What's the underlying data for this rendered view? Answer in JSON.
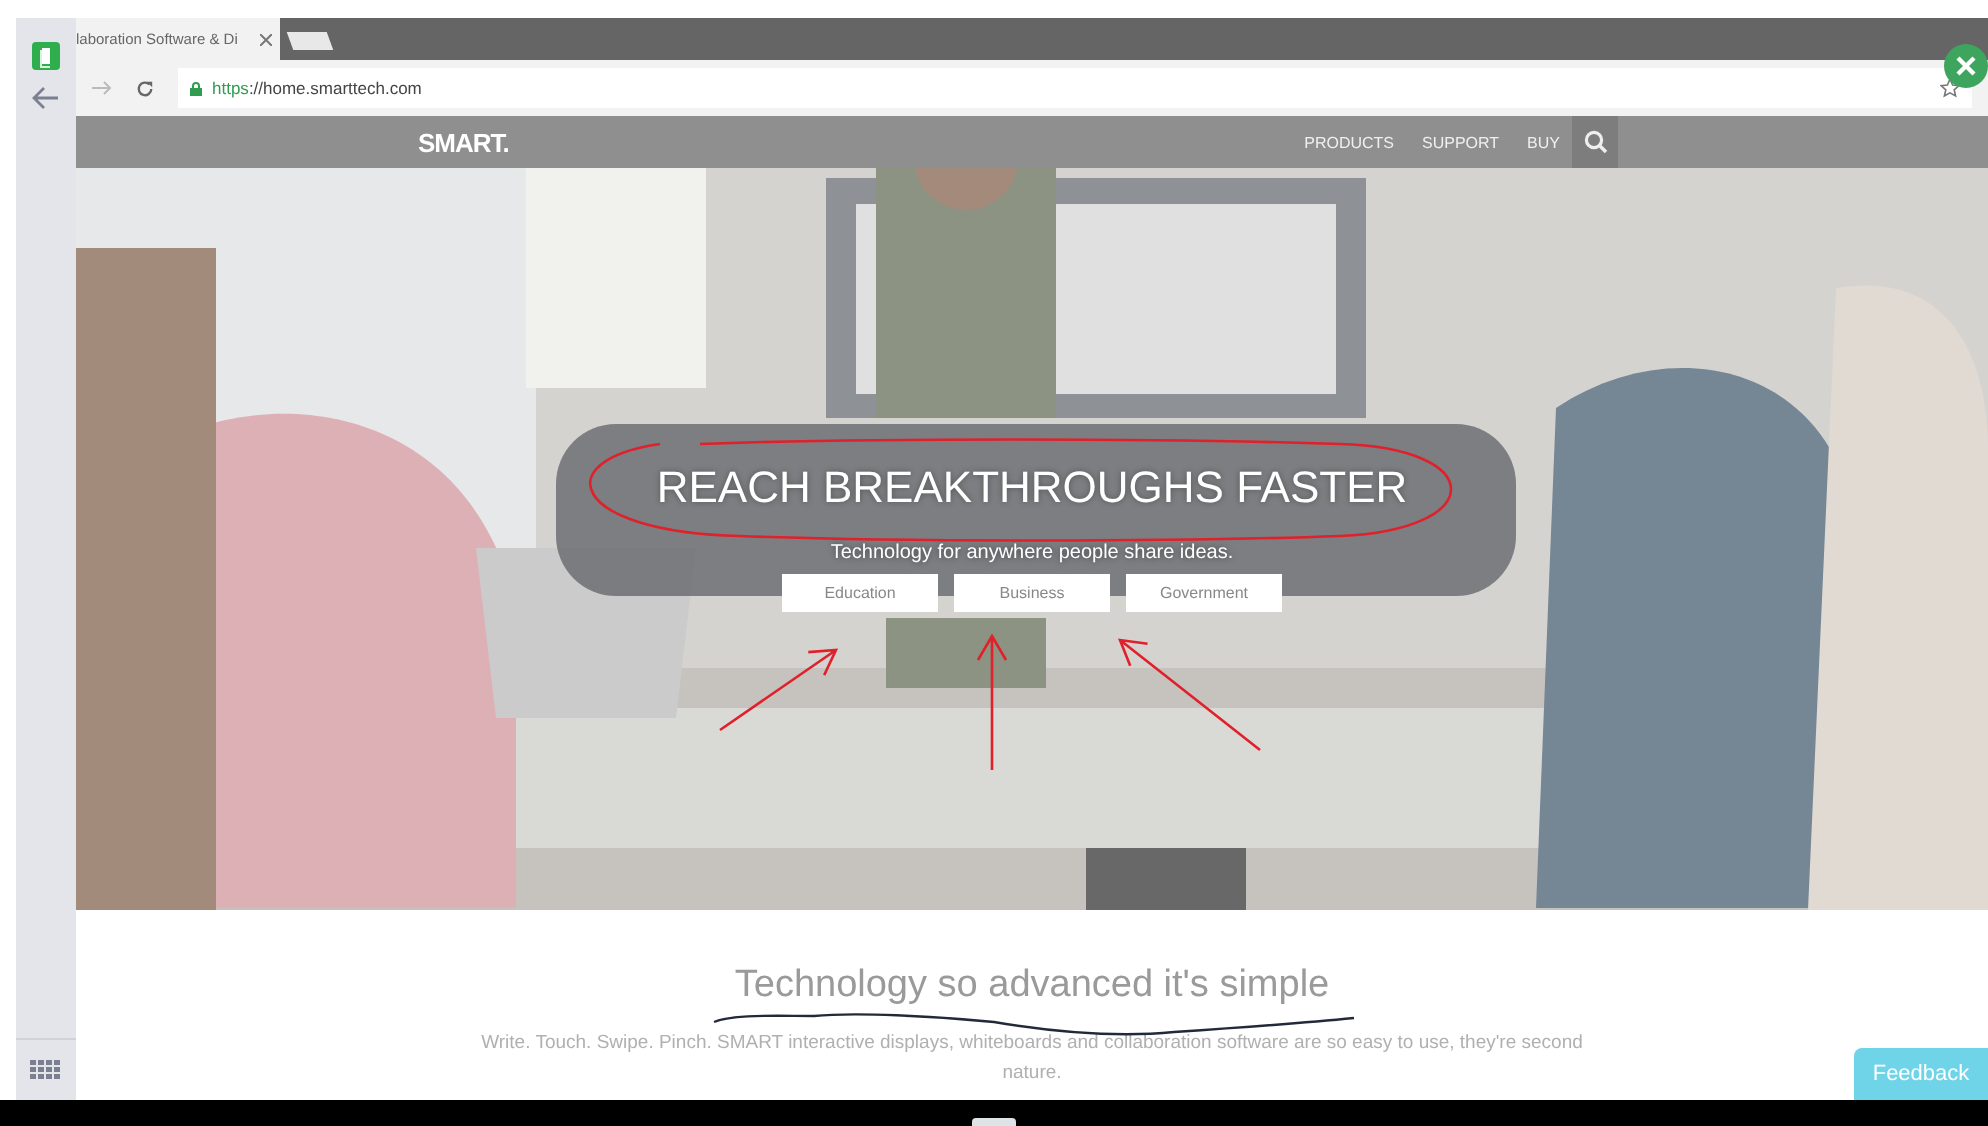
{
  "browser": {
    "tab_title": "laboration Software & Di",
    "url_scheme": "https",
    "url_rest": "://home.smarttech.com"
  },
  "site": {
    "logo": "SMART.",
    "nav": [
      "PRODUCTS",
      "SUPPORT",
      "BUY"
    ]
  },
  "hero": {
    "title": "REACH BREAKTHROUGHS FASTER",
    "subtitle": "Technology for anywhere people share ideas.",
    "buttons": [
      "Education",
      "Business",
      "Government"
    ]
  },
  "section": {
    "heading": "Technology so advanced it's simple",
    "body": "Write. Touch. Swipe. Pinch. SMART interactive displays, whiteboards and collaboration software are so easy to use, they're second nature."
  },
  "feedback": "Feedback"
}
